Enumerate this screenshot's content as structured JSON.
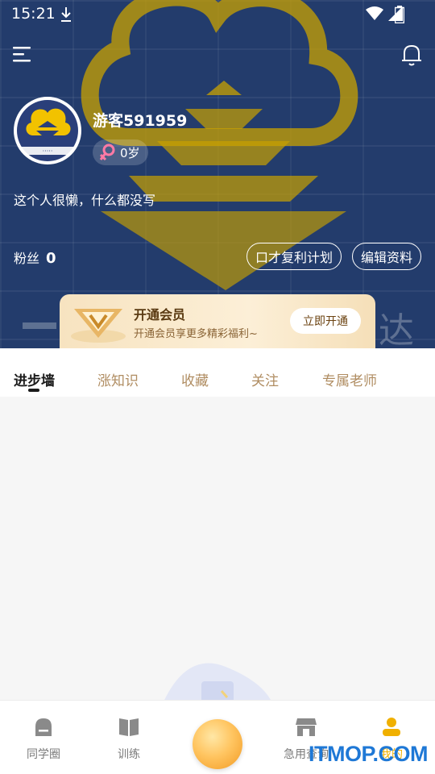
{
  "status_bar": {
    "time": "15:21"
  },
  "profile": {
    "username": "游客591959",
    "age": "0岁",
    "bio": "这个人很懒，什么都没写",
    "fans_label": "粉丝",
    "fans_count": "0",
    "buttons": {
      "plan": "口才复利计划",
      "edit": "编辑资料"
    }
  },
  "vip": {
    "title": "开通会员",
    "subtitle": "开通会员享更多精彩福利~",
    "button": "立即开通"
  },
  "tabs": [
    {
      "label": "进步墙",
      "active": true
    },
    {
      "label": "涨知识"
    },
    {
      "label": "收藏"
    },
    {
      "label": "关注"
    },
    {
      "label": "专属老师"
    }
  ],
  "bottom_nav": [
    {
      "label": "同学圈",
      "icon": "circle-icon"
    },
    {
      "label": "训练",
      "icon": "book-icon"
    },
    {
      "label": "",
      "icon": "center-orb-icon"
    },
    {
      "label": "急用查询",
      "icon": "store-icon"
    },
    {
      "label": "我的",
      "icon": "user-icon",
      "active": true
    }
  ],
  "watermark_text": "ITMOP.COM",
  "colors": {
    "header_bg": "#233c6c",
    "gold": "#f0b000",
    "vip_bg": "#fcefd7",
    "tab_inactive": "#b08d62"
  }
}
